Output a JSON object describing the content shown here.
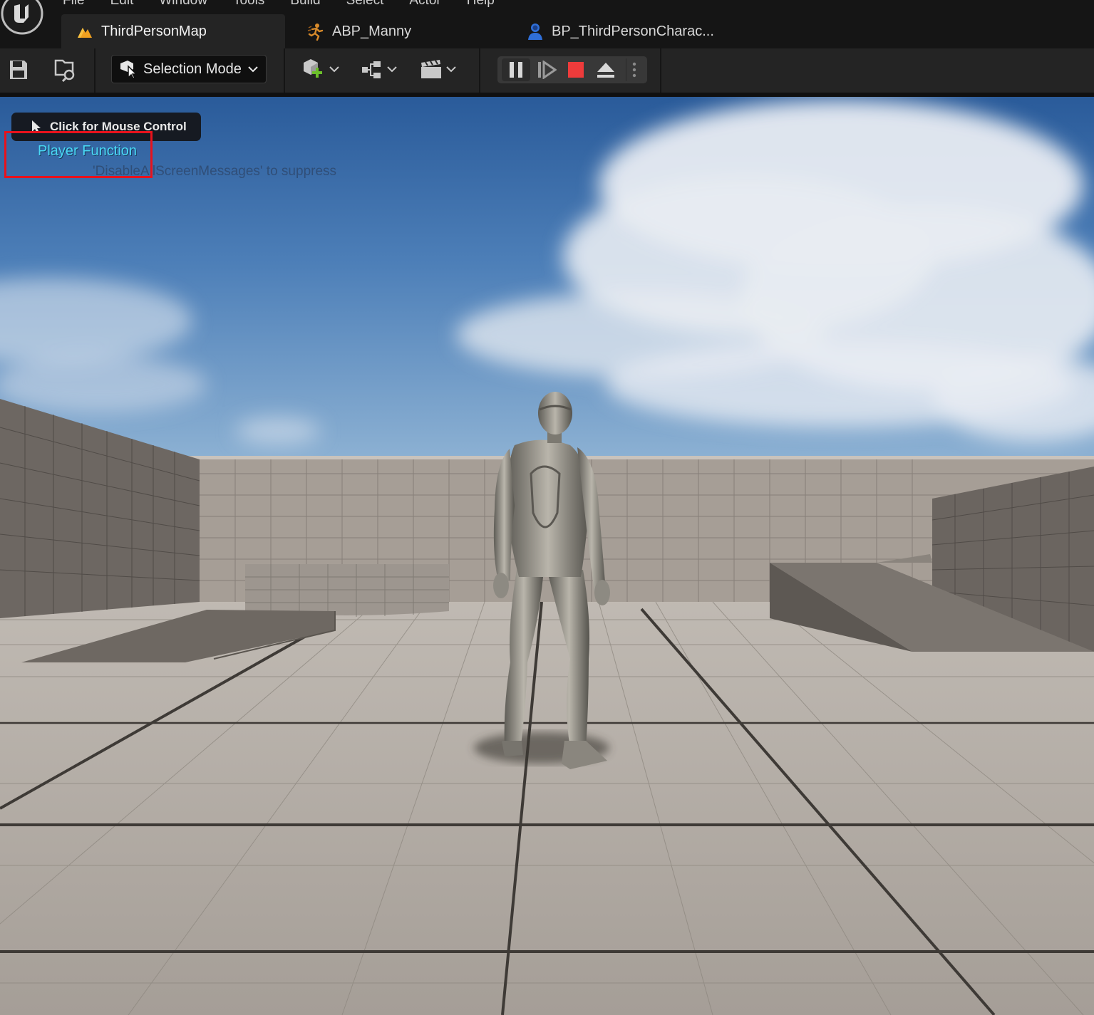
{
  "menu": {
    "items": [
      "File",
      "Edit",
      "Window",
      "Tools",
      "Build",
      "Select",
      "Actor",
      "Help"
    ]
  },
  "tabs": [
    {
      "label": "ThirdPersonMap",
      "icon": "level-map-icon",
      "active": true
    },
    {
      "label": "ABP_Manny",
      "icon": "animation-blueprint-icon",
      "active": false
    },
    {
      "label": "BP_ThirdPersonCharac...",
      "icon": "character-blueprint-icon",
      "active": false
    }
  ],
  "toolbar": {
    "selection_mode_label": "Selection Mode"
  },
  "viewport": {
    "mouse_control_label": "Click for Mouse Control",
    "player_function_message": "Player Function",
    "suppress_message": "'DisableAllScreenMessages' to suppress"
  },
  "colors": {
    "accent_blue": "#49d8f5",
    "highlight_red": "#e8121c",
    "stop_red": "#ee3b3b",
    "toolbar_bg": "#242424",
    "titlebar_bg": "#151515"
  }
}
